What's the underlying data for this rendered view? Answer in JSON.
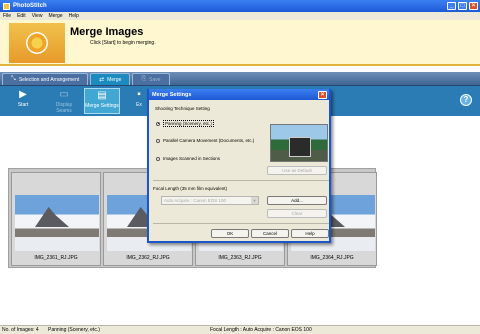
{
  "window": {
    "title": "PhotoStitch"
  },
  "menu": [
    "File",
    "Edit",
    "View",
    "Merge",
    "Help"
  ],
  "banner": {
    "title": "Merge Images",
    "subtitle": "Click [Start] to begin merging."
  },
  "tabs": [
    {
      "label": "Selection and Arrangement",
      "icon": "arrange-icon"
    },
    {
      "label": "Merge",
      "icon": "merge-icon"
    },
    {
      "label": "Save",
      "icon": "save-icon"
    }
  ],
  "toolbar": {
    "start": "Start",
    "display_seams": "Display Seams",
    "merge_settings": "Merge Settings",
    "partial": "Ex"
  },
  "images": [
    {
      "name": "IMG_2361_RJ.JPG"
    },
    {
      "name": "IMG_2362_RJ.JPG"
    },
    {
      "name": "IMG_2363_RJ.JPG"
    },
    {
      "name": "IMG_2364_RJ.JPG"
    }
  ],
  "dialog": {
    "title": "Merge Settings",
    "technique_label": "Shooting Technique Setting",
    "options": [
      "Panning (Scenery, etc.)",
      "Parallel Camera Movement (Documents, etc.)",
      "Images Scanned in Sections"
    ],
    "selected_option": 0,
    "use_default": "Use as Default",
    "focal_label": "Focal Length (35 mm film equivalent)",
    "focal_value": "Auto Acquire : Canon EOS 100",
    "add": "Add...",
    "clear": "Clear",
    "ok": "OK",
    "cancel": "Cancel",
    "help": "Help"
  },
  "status": {
    "count": "No. of Images: 4",
    "technique": "Panning (Scenery, etc.)",
    "focal": "Focal Length : Auto Acquire : Canon EOS 100"
  },
  "colors": {
    "titlebar": "#1d5ad6",
    "banner": "#fff7cf",
    "toolbar": "#2b7bb4"
  }
}
